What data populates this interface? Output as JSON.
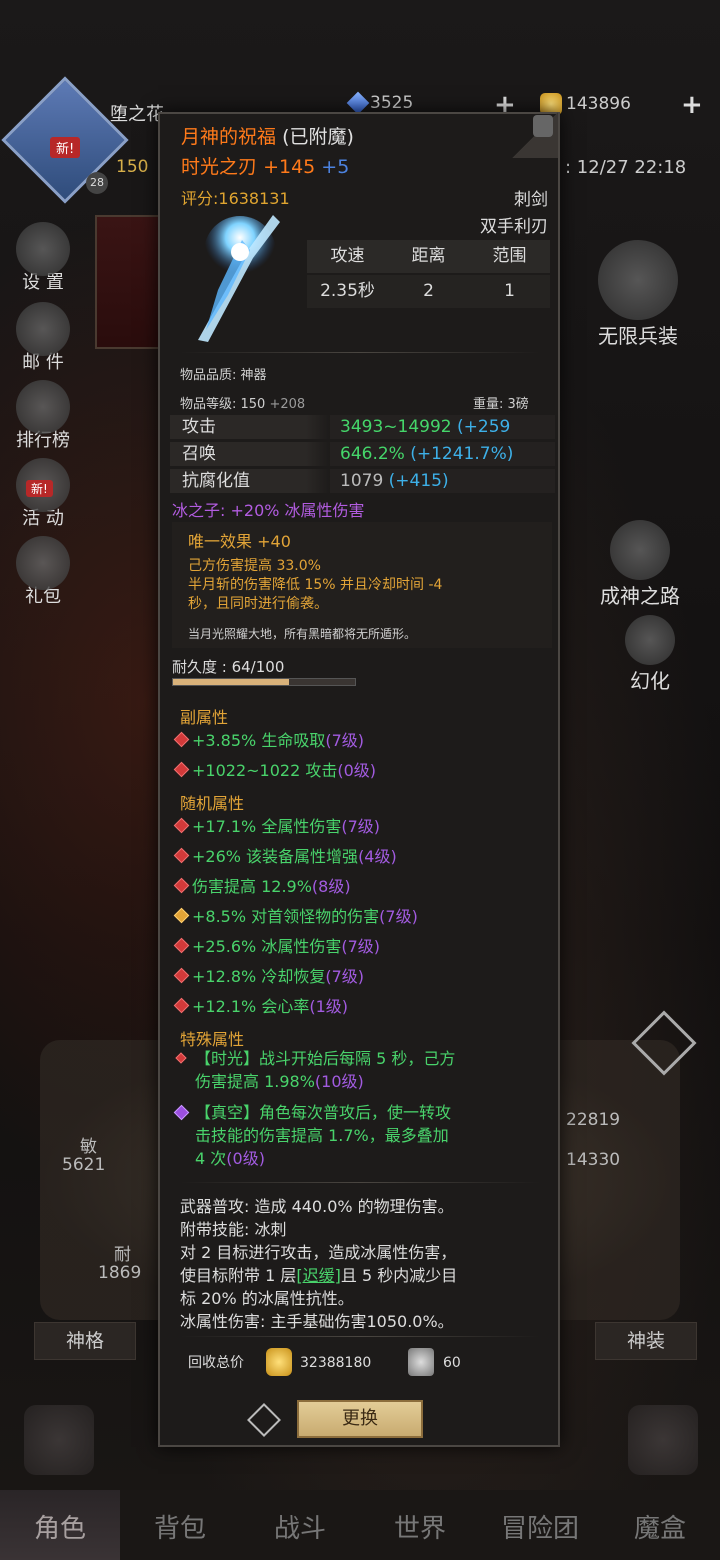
{
  "hud": {
    "player_name": "堕之花",
    "new_badge": "新!",
    "level": "28",
    "power": "150",
    "crystal": "3525",
    "gold": "143896",
    "datetime": ": 12/27 22:18"
  },
  "left_menu": [
    {
      "label": "设 置",
      "icon": "gear-icon"
    },
    {
      "label": "邮 件",
      "icon": "mail-icon"
    },
    {
      "label": "排行榜",
      "icon": "ranking-icon"
    },
    {
      "label": "活 动",
      "icon": "event-icon",
      "badge": "新!"
    },
    {
      "label": "礼包",
      "icon": "gift-icon"
    }
  ],
  "right_menu": [
    {
      "label": "无限兵装",
      "icon": "infinite-arms-icon"
    },
    {
      "label": "成神之路",
      "icon": "godhood-road-icon"
    },
    {
      "label": "幻化",
      "icon": "transmog-icon"
    }
  ],
  "background_stats": {
    "agility_label": "敏",
    "agility_value": "5621",
    "endurance_label": "耐",
    "endurance_value": "1869",
    "right_value1": "22819",
    "right_value2": "14330",
    "tab_left": "神格",
    "tab_right": "神装"
  },
  "item": {
    "name": "月神的祝福",
    "enchanted": "(已附魔)",
    "subname": "时光之刃",
    "plus": "+145",
    "plus2": "+5",
    "score": "评分:1638131",
    "weapon_type": "刺剑",
    "hand_type": "双手利刃",
    "speed_table": {
      "headers": [
        "攻速",
        "距离",
        "范围"
      ],
      "values": [
        "2.35秒",
        "2",
        "1"
      ]
    },
    "quality": "物品品质: 神器",
    "item_level_label": "物品等级: ",
    "item_level": "150",
    "item_level_bonus": "+208",
    "weight": "重量: 3磅",
    "attributes": [
      {
        "label": "攻击",
        "value": "3493~14992",
        "bonus": "(+259"
      },
      {
        "label": "召唤",
        "value": "646.2%",
        "bonus": "(+1241.7%)"
      },
      {
        "label": "抗腐化值",
        "value": "1079",
        "bonus": "(+415)"
      }
    ],
    "ice_line": "冰之子: +20% 冰属性伤害",
    "unique": {
      "title": "唯一效果",
      "bonus": "+40",
      "line1": "己方伤害提高 33.0%",
      "line2": "半月斩的伤害降低 15% 并且冷却时间 -4",
      "line3": "秒，且同时进行偷袭。",
      "flavor": "当月光照耀大地，所有黑暗都将无所遁形。"
    },
    "durability_label": "耐久度 : 64/100",
    "durability_fraction": 0.64,
    "sub_title": "副属性",
    "sub_stats": [
      {
        "text": "+3.85% 生命吸取",
        "level": "(7级)",
        "icon": "red"
      },
      {
        "text": "+1022~1022 攻击",
        "level": "(0级)",
        "icon": "red"
      }
    ],
    "random_title": "随机属性",
    "random_stats": [
      {
        "text": "+17.1% 全属性伤害",
        "level": "(7级)",
        "icon": "red"
      },
      {
        "text": "+26% 该装备属性增强",
        "level": "(4级)",
        "icon": "red"
      },
      {
        "text": "伤害提高 12.9%",
        "level": "(8级)",
        "icon": "red"
      },
      {
        "text": "+8.5% 对首领怪物的伤害",
        "level": "(7级)",
        "icon": "gold"
      },
      {
        "text": "+25.6% 冰属性伤害",
        "level": "(7级)",
        "icon": "red"
      },
      {
        "text": "+12.8% 冷却恢复",
        "level": "(7级)",
        "icon": "red"
      },
      {
        "text": "+12.1% 会心率",
        "level": "(1级)",
        "icon": "red"
      }
    ],
    "special_title": "特殊属性",
    "special1_a": "【时光】战斗开始后每隔 5 秒，己方",
    "special1_b": "伤害提高 1.98%",
    "special1_level": "(10级)",
    "special2_a": "【真空】角色每次普攻后，使一转攻",
    "special2_b": "击技能的伤害提高 1.7%，最多叠加",
    "special2_c": "4 次",
    "special2_level": "(0级)",
    "desc1": "武器普攻: 造成 440.0% 的物理伤害。",
    "desc2": "附带技能: 冰刺",
    "desc3": "对 2 目标进行攻击，造成冰属性伤害，",
    "desc4a": "使目标附带 1 层",
    "desc4_link": "[迟缓]",
    "desc4b": "且 5 秒内减少目",
    "desc5": "标 20% 的冰属性抗性。",
    "desc6": "冰属性伤害: 主手基础伤害1050.0%。",
    "recycle_label": "回收总价",
    "recycle_gold": "32388180",
    "recycle_scroll": "60",
    "change_button": "更换"
  },
  "bottom_nav": [
    "角色",
    "背包",
    "战斗",
    "世界",
    "冒险团",
    "魔盒"
  ],
  "colors": {
    "legendary_orange": "#ff7a1a",
    "stat_green": "#49d36b",
    "level_purple": "#a25be0",
    "gold_text": "#e2a437"
  }
}
